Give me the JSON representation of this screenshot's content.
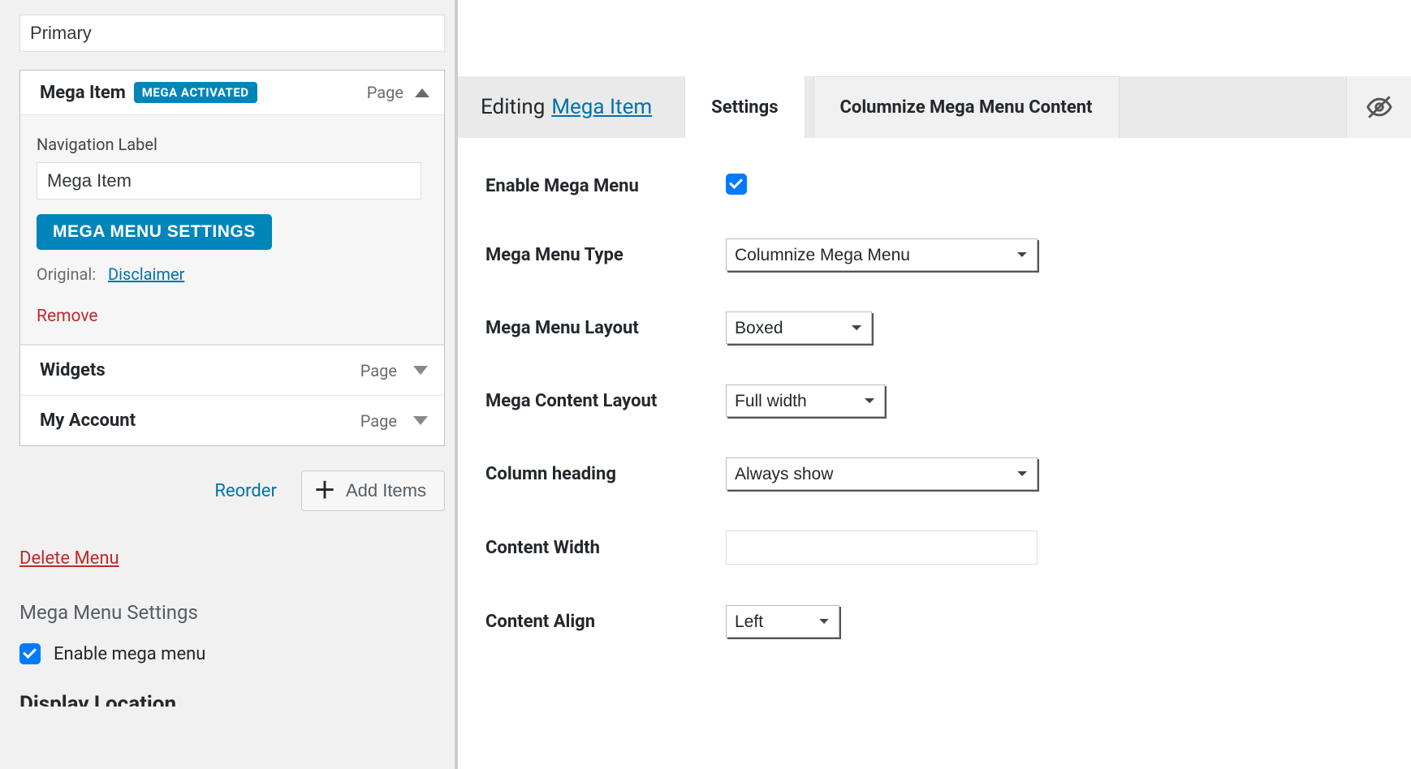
{
  "left": {
    "menu_name": "Primary",
    "items": [
      {
        "title": "Mega Item",
        "badge": "MEGA ACTIVATED",
        "type": "Page",
        "expanded": true,
        "nav_label_field": "Navigation Label",
        "nav_label_value": "Mega Item",
        "mega_button": "MEGA MENU SETTINGS",
        "original_label": "Original:",
        "original_link": "Disclaimer",
        "remove": "Remove"
      },
      {
        "title": "Widgets",
        "type": "Page",
        "expanded": false
      },
      {
        "title": "My Account",
        "type": "Page",
        "expanded": false
      }
    ],
    "reorder": "Reorder",
    "add_items": "Add Items",
    "delete_menu": "Delete Menu",
    "section_heading": "Mega Menu Settings",
    "enable_label": "Enable mega menu"
  },
  "right": {
    "editing_prefix": "Editing",
    "editing_link": "Mega Item",
    "tabs": {
      "settings": "Settings",
      "columnize": "Columnize Mega Menu Content"
    },
    "settings": {
      "enable": {
        "label": "Enable Mega Menu",
        "checked": true
      },
      "type": {
        "label": "Mega Menu Type",
        "value": "Columnize Mega Menu"
      },
      "layout": {
        "label": "Mega Menu Layout",
        "value": "Boxed"
      },
      "content_layout": {
        "label": "Mega Content Layout",
        "value": "Full width"
      },
      "column_heading": {
        "label": "Column heading",
        "value": "Always show"
      },
      "content_width": {
        "label": "Content Width",
        "value": ""
      },
      "content_align": {
        "label": "Content Align",
        "value": "Left"
      }
    }
  }
}
